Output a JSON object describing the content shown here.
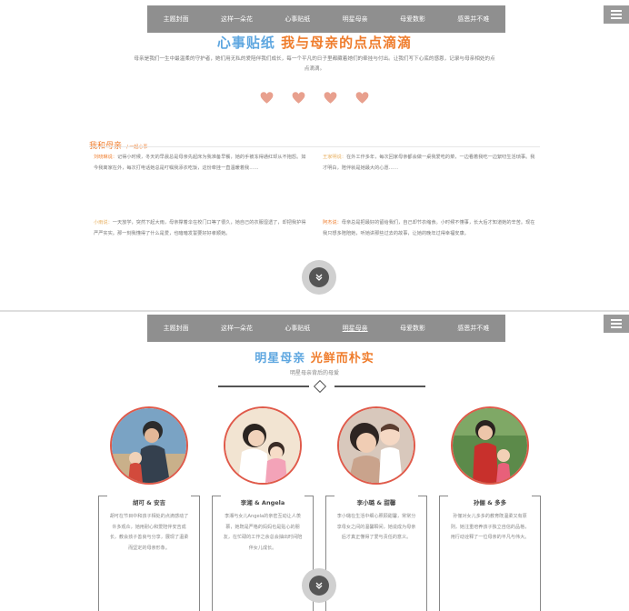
{
  "nav": {
    "items": [
      "主题封面",
      "这样一朵花",
      "心事贴纸",
      "明星母亲",
      "母爱数影",
      "感恩并不难"
    ]
  },
  "section1": {
    "title_a": "心事贴纸",
    "title_b": "我与母亲的点点滴滴",
    "intro": "母亲是我们一生中最温柔的守护者，她们用无私的爱陪伴我们成长，每一个平凡的日子里都藏着她们的牵挂与付出。让我们写下心底的感恩，记录与母亲相处的点点滴滴。",
    "section_heading": "我和母亲",
    "section_sub": "一起心事",
    "stories": [
      {
        "name": "刘晓琳说：",
        "text": "记得小时候，冬天的早晨总是母亲先起床为我准备早餐，她的手被冻得通红却从不抱怨。如今我离家在外，每次打电话她总是叮嘱我添衣吃饭，这份牵挂一直温暖着我……"
      },
      {
        "name": "王家明说：",
        "text": "在外工作多年，每次回家母亲都会做一桌我爱吃的菜，一边看着我吃一边絮叨生活琐事。我才明白，陪伴就是她最大的心愿……"
      },
      {
        "name": "小雨说：",
        "text": "一天放学，突然下起大雨，母亲撑着伞在校门口等了很久，她自己的衣服湿透了，却把我护得严严实实。那一刻我懂得了什么是爱，也暗暗发誓要好好孝顺她。"
      },
      {
        "name": "阿杰说：",
        "text": "母亲总是把最好的留给我们，自己却节衣缩食。小时候不懂事，长大后才知道她的辛苦。现在我只想多陪陪她，听她讲那些过去的故事，让她的晚年过得幸福安康。"
      }
    ]
  },
  "section2": {
    "title_a": "明星母亲",
    "title_b": "光鲜而朴实",
    "subtitle": "明星母亲背后的母爱",
    "mothers": [
      {
        "name": "胡可 & 安吉",
        "text": "胡可在节目中和孩子相处的点滴感动了许多观众，她用耐心和爱陪伴安吉成长，教会孩子善良与分享，展现了温柔而坚定的母亲形象。"
      },
      {
        "name": "李湘 & Angela",
        "text": "李湘与女儿Angela的亲密互动让人羡慕，她既是严格的妈妈也是贴心的朋友，在忙碌的工作之余总会抽出时间陪伴女儿成长。"
      },
      {
        "name": "李小璐 & 甜馨",
        "text": "李小璐在生活中细心照顾甜馨，常常分享母女之间的温馨瞬间，她说成为母亲后才真正懂得了爱与责任的意义。"
      },
      {
        "name": "孙俪 & 多多",
        "text": "孙俪对女儿多多的教育既温柔又有原则，她注重培养孩子独立自信的品格，用行动诠释了一位母亲的平凡与伟大。"
      }
    ]
  },
  "colors": {
    "nav_bg": "#8f8f8f",
    "title_blue": "#5fa7e0",
    "title_orange": "#ef7d2d",
    "heart": "#e8a08e",
    "photo_border": "#e05a4a"
  }
}
